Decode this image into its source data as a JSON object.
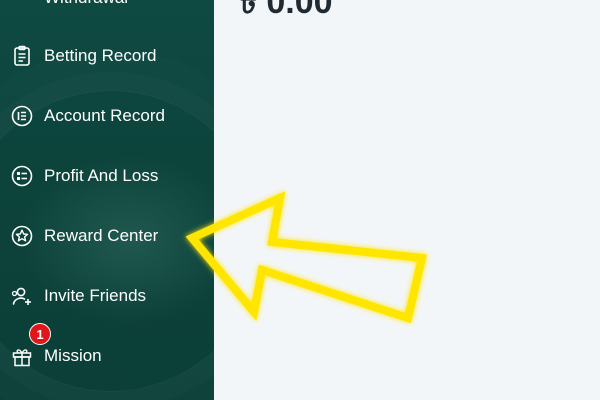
{
  "sidebar": {
    "items": [
      {
        "label": "Withdrawal",
        "icon": "withdrawal-icon"
      },
      {
        "label": "Betting Record",
        "icon": "clipboard-icon"
      },
      {
        "label": "Account Record",
        "icon": "list-circle-icon"
      },
      {
        "label": "Profit And Loss",
        "icon": "list-card-icon"
      },
      {
        "label": "Reward Center",
        "icon": "star-icon"
      },
      {
        "label": "Invite Friends",
        "icon": "add-user-icon"
      },
      {
        "label": "Mission",
        "icon": "gift-icon",
        "badge": "1"
      }
    ]
  },
  "main": {
    "balance": "৳ 0.00"
  },
  "annotation": {
    "arrow_color": "#ffe600",
    "points_to": "Reward Center"
  },
  "colors": {
    "sidebar_bg": "#0c433b",
    "main_bg": "#f3f6f9",
    "badge_bg": "#e0161b",
    "text_light": "#ffffff",
    "text_dark": "#1f2a33"
  }
}
